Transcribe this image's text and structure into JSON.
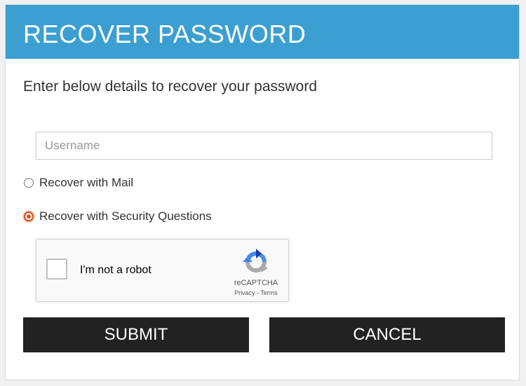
{
  "header": {
    "title": "RECOVER PASSWORD",
    "color": "#3b9fd1"
  },
  "form": {
    "instruction": "Enter below details to recover your password",
    "username": {
      "placeholder": "Username",
      "value": ""
    },
    "options": [
      {
        "label": "Recover with Mail",
        "checked": false
      },
      {
        "label": "Recover with Security Questions",
        "checked": true
      }
    ]
  },
  "recaptcha": {
    "label": "I'm not a robot",
    "brand": "reCAPTCHA",
    "privacy": "Privacy",
    "separator": " - ",
    "terms": "Terms",
    "icon": "recaptcha-logo-icon"
  },
  "buttons": {
    "submit": "SUBMIT",
    "cancel": "CANCEL"
  }
}
